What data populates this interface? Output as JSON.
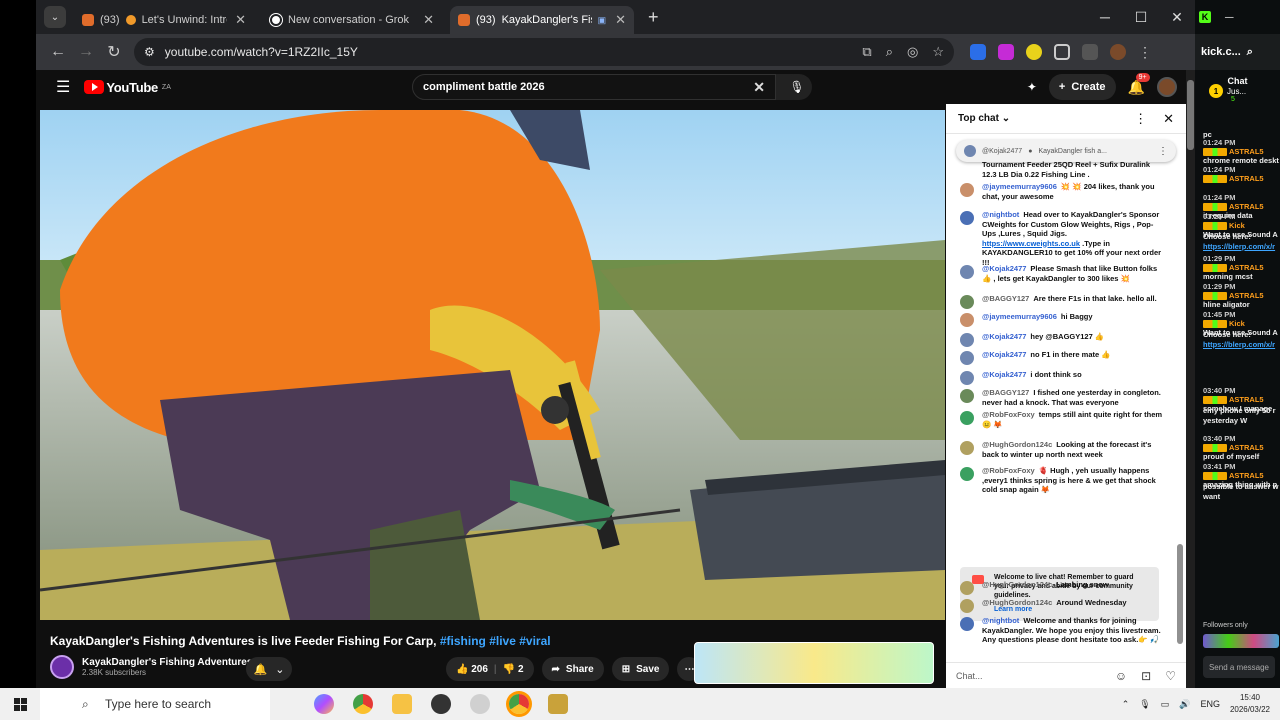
{
  "tabs": [
    {
      "count": "(93)",
      "title": "Let's Unwind: Introvert",
      "audio": true,
      "active": false
    },
    {
      "count": "",
      "title": "New conversation - Grok",
      "audio": false,
      "active": false
    },
    {
      "count": "(93)",
      "title": "KayakDangler's Fishing",
      "audio": false,
      "active": true
    }
  ],
  "address": {
    "url": "youtube.com/watch?v=1RZ2IIc_15Y"
  },
  "youtube": {
    "logo_text": "YouTube",
    "region": "ZA",
    "search_value": "compliment battle 2026",
    "create_label": "Create",
    "notif_count": "9+"
  },
  "video": {
    "title_main": "KayakDangler's Fishing Adventures is live Feeder Fishing For Carp, ",
    "title_tags": "#fishing #live #viral",
    "channel_name": "KayakDangler's Fishing Adventures",
    "subscribers": "2.38K subscribers",
    "likes": "206",
    "dislikes": "2",
    "share_label": "Share",
    "save_label": "Save"
  },
  "chat": {
    "header": "Top chat",
    "pinned_author": "@Kojak2477",
    "pinned_text": "KayakDangler fish a...",
    "messages": [
      {
        "author": "",
        "text": "Tournament Feeder 25QD Reel + Sufix Duralink 12.3 LB Dia 0.22 Fishing Line .",
        "avatar": "#6f86b0"
      },
      {
        "author": "@jaymeemurray9606",
        "text": "💥 💥 204 likes, thank you chat, your awesome",
        "avatar": "#c98f6a"
      },
      {
        "author": "@nightbot",
        "text": "Head over to KayakDangler's Sponsor CWeights for Custom Glow Weights, Rigs , Pop-Ups ,Lures , Squid Jigs. ",
        "link": "https://www.cweights.co.uk",
        "text2": " .Type in KAYAKDANGLER10 to get 10% off your next order !!!",
        "avatar": "#4a6fb5"
      },
      {
        "author": "@Kojak2477",
        "text": "Please Smash that like Button folks 👍 , lets get KayakDangler to 300 likes 💥",
        "avatar": "#6f86b0"
      },
      {
        "author": "@BAGGY127",
        "text": "Are there F1s in that lake. hello all.",
        "avatar": "#6a8a5a",
        "plain": true
      },
      {
        "author": "@jaymeemurray9606",
        "text": "hi Baggy",
        "avatar": "#c98f6a"
      },
      {
        "author": "@Kojak2477",
        "text": "hey @BAGGY127 👍",
        "avatar": "#6f86b0"
      },
      {
        "author": "@Kojak2477",
        "text": "no F1 in there mate 👍",
        "avatar": "#6f86b0"
      },
      {
        "author": "@Kojak2477",
        "text": "i dont think so",
        "avatar": "#6f86b0"
      },
      {
        "author": "@BAGGY127",
        "text": "I fished one yesterday in congleton. never had a knock. That was everyone",
        "avatar": "#6a8a5a",
        "plain": true
      },
      {
        "author": "@RobFoxFoxy",
        "text": "temps still aint quite right for them 😐 🦊",
        "avatar": "#3aa060",
        "plain": true
      },
      {
        "author": "@HughGordon124c",
        "text": "Looking at the forecast it's back to winter up north next week",
        "avatar": "#b0a060",
        "plain": true
      },
      {
        "author": "@RobFoxFoxy",
        "text": "🫀 Hugh , yeh usually happens ,every1 thinks spring is here & we get that shock cold snap again 🦊",
        "avatar": "#3aa060",
        "plain": true
      },
      {
        "author": "@HughGordon124c",
        "text": "Lambing snow",
        "avatar": "#b0a060",
        "plain": true
      },
      {
        "author": "@HughGordon124c",
        "text": "Around Wednesday",
        "avatar": "#b0a060",
        "plain": true
      },
      {
        "author": "@nightbot",
        "text": "Welcome and thanks for joining KayakDangler. We hope you enjoy this livestream. Any questions please dont hesitate too ask.👉 🎣",
        "avatar": "#4a6fb5"
      }
    ],
    "welcome_text": "Welcome to live chat! Remember to guard your privacy and abide by our community guidelines.",
    "learn_more": "Learn more",
    "input_placeholder": "Chat..."
  },
  "kick": {
    "url": "kick.c...",
    "chat_title": "Chat",
    "top_user": "Jus...",
    "top_user_level": "1",
    "top_user_count": "5",
    "messages": [
      {
        "time": "",
        "name": "",
        "text": "pc"
      },
      {
        "time": "01:24 PM",
        "name": "ASTRAL5",
        "text": "chrome remote deskt"
      },
      {
        "time": "01:24 PM",
        "name": "ASTRAL5",
        "text": ""
      },
      {
        "time": "01:24 PM",
        "name": "ASTRAL5",
        "text": "it require data"
      },
      {
        "time": "01:25 PM",
        "name": "Kick",
        "text": "Want to use Sound A"
      },
      {
        "time": "",
        "name": "",
        "text": "Choose here:"
      },
      {
        "time": "",
        "name": "",
        "text": "https://blerp.com/x/r",
        "link": true
      },
      {
        "time": "01:29 PM",
        "name": "ASTRAL5",
        "text": "morning mcst"
      },
      {
        "time": "01:29 PM",
        "name": "ASTRAL5",
        "text": "hline aligator"
      },
      {
        "time": "01:45 PM",
        "name": "Kick",
        "text": "Want to use Sound A"
      },
      {
        "time": "",
        "name": "",
        "text": "Choose here:"
      },
      {
        "time": "",
        "name": "",
        "text": "https://blerp.com/x/r",
        "link": true
      },
      {
        "time": "03:40 PM",
        "name": "ASTRAL5",
        "text": "somehow I manage"
      },
      {
        "time": "",
        "name": "",
        "text": "emy phone only 50 r"
      },
      {
        "time": "",
        "name": "",
        "text": "yesterday W"
      },
      {
        "time": "03:40 PM",
        "name": "ASTRAL5",
        "text": "proud of myself"
      },
      {
        "time": "03:41 PM",
        "name": "ASTRAL5",
        "text": "amazing thing with p"
      },
      {
        "time": "",
        "name": "",
        "text": "possible to answer w"
      },
      {
        "time": "",
        "name": "",
        "text": "want"
      }
    ],
    "followers_only": "Followers only",
    "send_placeholder": "Send a message"
  },
  "taskbar": {
    "search_placeholder": "Type here to search",
    "lang": "ENG",
    "time": "15:40",
    "date": "2026/03/22"
  }
}
